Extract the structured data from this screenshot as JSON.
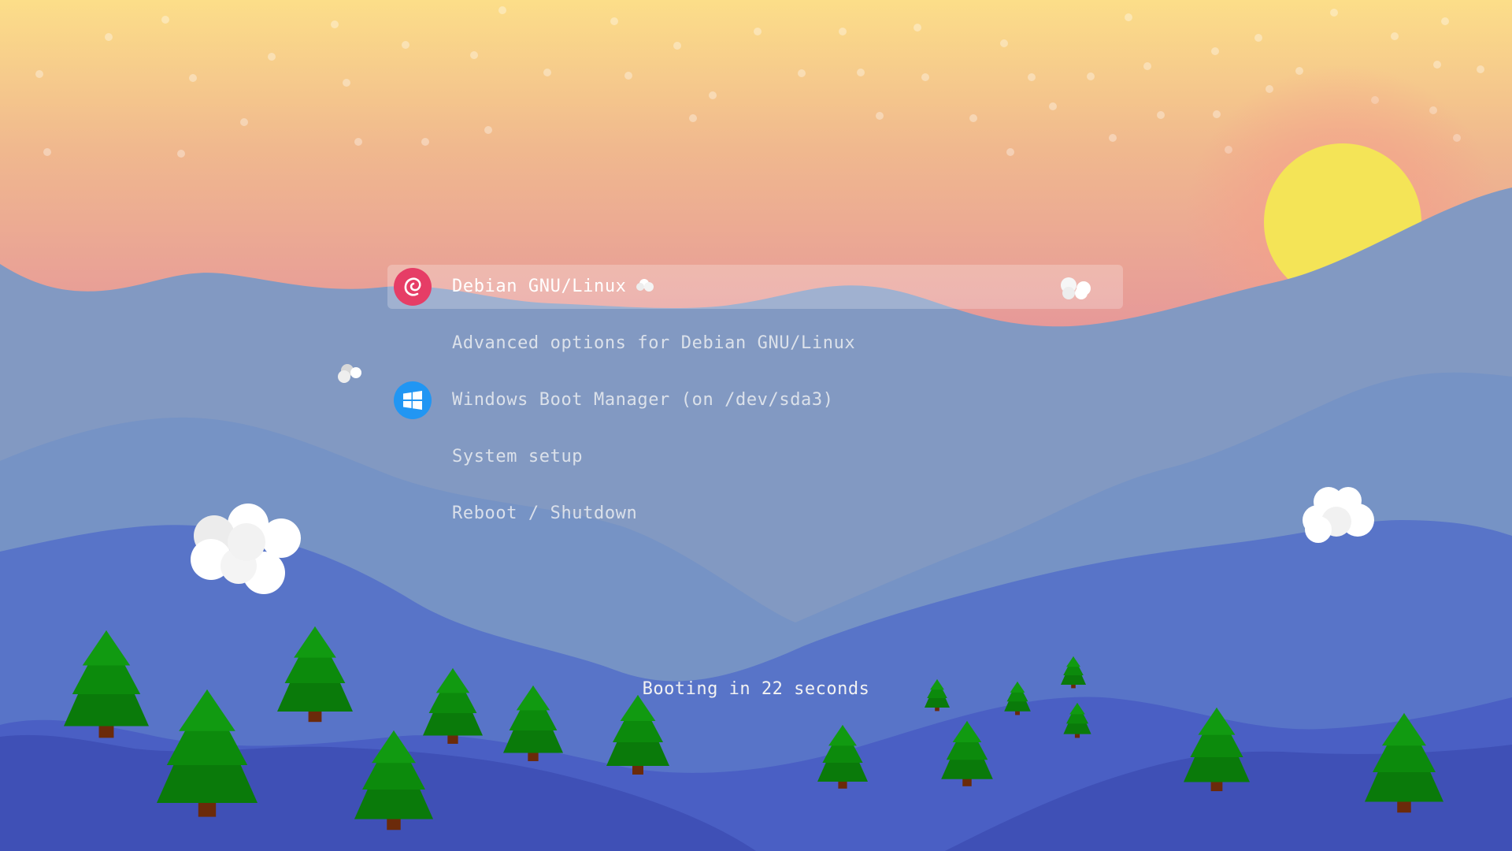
{
  "menu": {
    "entries": [
      {
        "label": "Debian GNU/Linux",
        "icon": "debian-swirl-icon",
        "selected": true
      },
      {
        "label": "Advanced options for Debian GNU/Linux",
        "icon": "",
        "selected": false
      },
      {
        "label": "Windows Boot Manager (on /dev/sda3)",
        "icon": "windows-logo-icon",
        "selected": false
      },
      {
        "label": "System setup",
        "icon": "",
        "selected": false
      },
      {
        "label": "Reboot / Shutdown",
        "icon": "",
        "selected": false
      }
    ]
  },
  "status": {
    "countdown_text": "Booting in 22 seconds"
  },
  "colors": {
    "sky_top": "#fbdc8a",
    "sky_bottom": "#e89e9c",
    "sun": "#f4e457",
    "debian_red": "#e63d66",
    "windows_blue": "#2196f3",
    "tree_green": "#0a8a0a",
    "trunk_brown": "#6b2a0a"
  }
}
